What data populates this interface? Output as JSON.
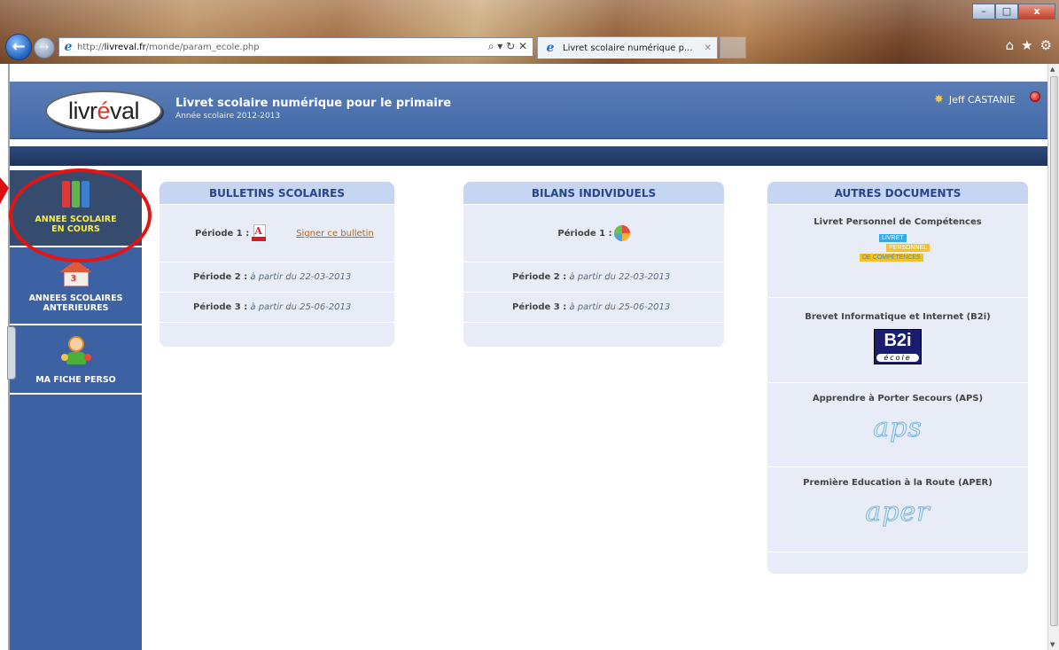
{
  "browser": {
    "url_prefix": "http://",
    "url_host": "livreval.fr",
    "url_path": "/monde/param_ecole.php",
    "address_tools": "⌕ ▾ ↻ ✕",
    "tab_title": "Livret scolaire numérique p...",
    "tab_close": "✕",
    "back_icon": "back-arrow-icon",
    "forward_icon": "forward-arrow-icon",
    "window_minimize": "–",
    "window_maximize": "□",
    "window_close": "x"
  },
  "header": {
    "logo_pre": "livr",
    "logo_accent": "é",
    "logo_post": "val",
    "title": "Livret scolaire numérique pour le primaire",
    "subtitle": "Année scolaire 2012-2013",
    "user_name": "Jeff CASTANIE"
  },
  "sidebar": {
    "items": [
      {
        "label_line1": "ANNEE SCOLAIRE",
        "label_line2": "EN COURS",
        "icon": "binders-icon",
        "active": true
      },
      {
        "label_line1": "ANNEES SCOLAIRES",
        "label_line2": "ANTERIEURES",
        "icon": "school-house-icon",
        "active": false
      },
      {
        "label_line1": "MA FICHE PERSO",
        "label_line2": "",
        "icon": "child-icon",
        "active": false
      }
    ]
  },
  "bulletins": {
    "title": "BULLETINS SCOLAIRES",
    "rows": [
      {
        "period": "Période 1 :",
        "date": "",
        "link": "Signer ce bulletin"
      },
      {
        "period": "Période 2 :",
        "date": "à partir du 22-03-2013"
      },
      {
        "period": "Période 3 :",
        "date": "à partir du 25-06-2013"
      }
    ]
  },
  "bilans": {
    "title": "BILANS INDIVIDUELS",
    "rows": [
      {
        "period": "Période 1 :",
        "date": ""
      },
      {
        "period": "Période 2 :",
        "date": "à partir du 22-03-2013"
      },
      {
        "period": "Période 3 :",
        "date": "à partir du 25-06-2013"
      }
    ]
  },
  "autres": {
    "title": "AUTRES DOCUMENTS",
    "docs": [
      {
        "title": "Livret Personnel de Compétences",
        "logo_words": [
          "LIVRET",
          "PERSONNEL",
          "DE COMPÉTENCES"
        ]
      },
      {
        "title": "Brevet Informatique et Internet (B2i)",
        "logo_main": "B2i",
        "logo_sub": "école"
      },
      {
        "title": "Apprendre à Porter Secours (APS)",
        "logo_text": "aps"
      },
      {
        "title": "Première Education à la Route (APER)",
        "logo_text": "aper"
      }
    ]
  },
  "colors": {
    "header_blue": "#4a70ad",
    "sidebar_blue": "#3c62a3",
    "panel_bg": "#e7ecf7",
    "panel_head": "#c6d5f1",
    "active_label": "#f5ec4a",
    "highlight_red": "#e21414"
  }
}
